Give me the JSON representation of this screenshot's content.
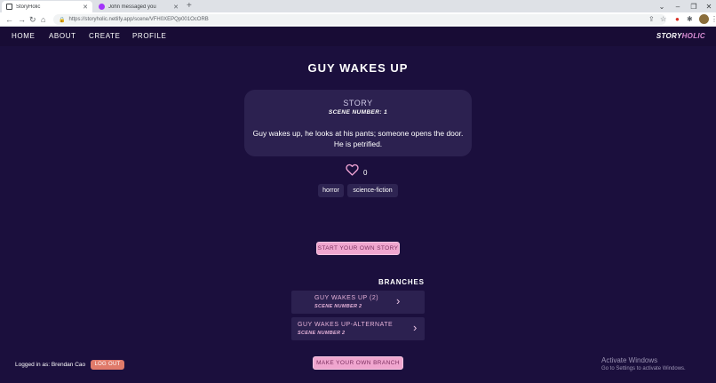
{
  "browser": {
    "tabs": [
      {
        "title": "StoryHolic",
        "active": true,
        "favicon_color": "#3c4043"
      },
      {
        "title": "John messaged you",
        "active": false,
        "favicon_color": "#a334fa"
      }
    ],
    "new_tab": "+",
    "url": "https://storyholic.netlify.app/scene/VFH0XEPQp001OcORB",
    "window_controls": [
      "⌄",
      "–",
      "❐",
      "✕"
    ]
  },
  "nav": {
    "links": [
      "HOME",
      "ABOUT",
      "CREATE",
      "PROFILE"
    ],
    "brand_part1": "STORY",
    "brand_part2": "HOLIC"
  },
  "scene": {
    "title": "GUY WAKES UP",
    "card_heading": "STORY",
    "scene_number": "SCENE NUMBER: 1",
    "text": "Guy wakes up, he looks at his pants; someone opens the door. He is petrified.",
    "likes": "0",
    "tags": [
      "horror",
      "science-fiction"
    ]
  },
  "actions": {
    "start_story": "START YOUR OWN STORY",
    "make_branch": "MAKE YOUR OWN BRANCH"
  },
  "branches": {
    "heading": "BRANCHES",
    "items": [
      {
        "title": "GUY WAKES UP (2)",
        "scene": "SCENE NUMBER 2"
      },
      {
        "title": "GUY WAKES UP-ALTERNATE",
        "scene": "SCENE NUMBER 2"
      }
    ]
  },
  "user": {
    "logged_in_text": "Logged in as: Brendan Cao",
    "logout_label": "LOG OUT"
  },
  "os_watermark": {
    "line1": "Activate Windows",
    "line2": "Go to Settings to activate Windows."
  },
  "colors": {
    "background": "#1b0f3d",
    "card": "#2c2150",
    "accent_pink": "#f0a6cf",
    "logout": "#e07a6a"
  }
}
